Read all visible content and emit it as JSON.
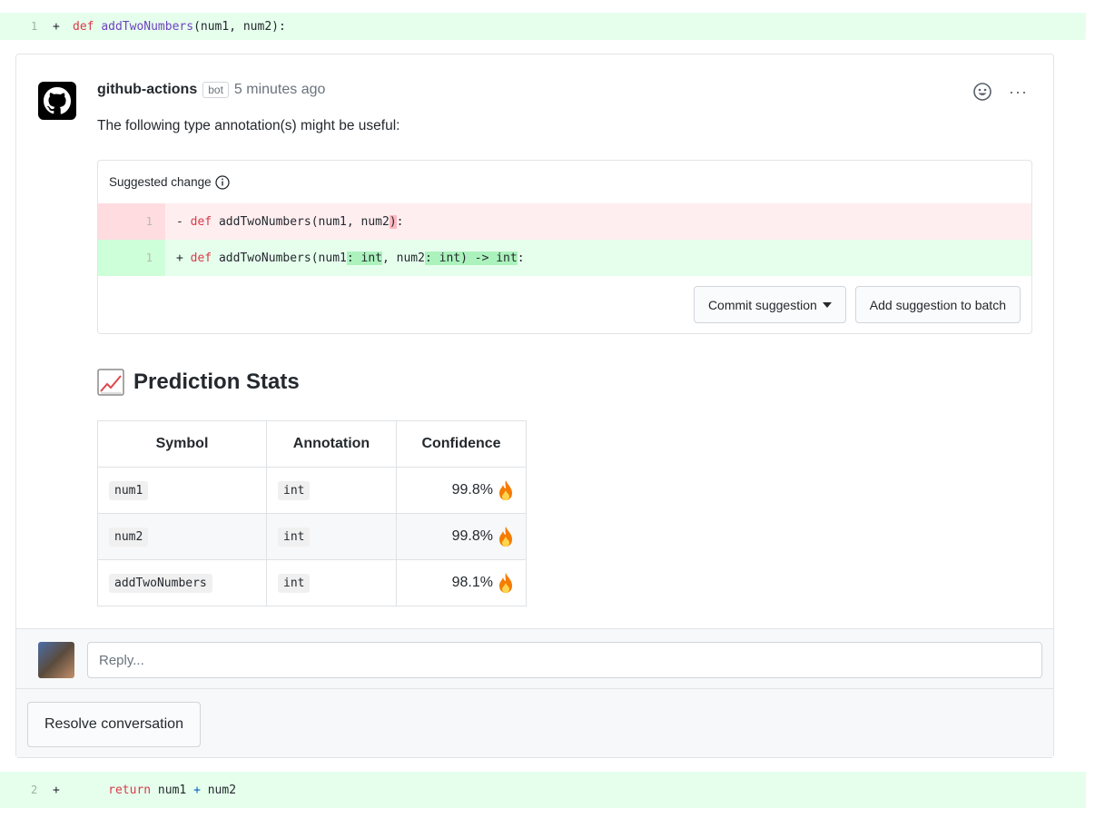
{
  "top_diff": {
    "line_number": "1",
    "sign": "+",
    "keyword": "def",
    "function": "addTwoNumbers",
    "args": "(num1, num2):"
  },
  "comment": {
    "author": "github-actions",
    "badge": "bot",
    "time": "5 minutes ago",
    "text": "The following type annotation(s) might be useful:",
    "more_label": "···"
  },
  "suggestion": {
    "header": "Suggested change",
    "deleted": {
      "line_number": "1",
      "sign": "-",
      "keyword": "def",
      "code_pre": " addTwoNumbers(num1, num2",
      "code_hl": ")",
      "code_post": ":"
    },
    "added": {
      "line_number": "1",
      "sign": "+",
      "keyword": "def",
      "seg1": " addTwoNumbers(num1",
      "hl1": ": int",
      "seg2": ", num2",
      "hl2": ": int) -> int",
      "seg3": ":"
    },
    "commit_label": "Commit suggestion",
    "batch_label": "Add suggestion to batch"
  },
  "stats": {
    "title": "Prediction Stats",
    "columns": [
      "Symbol",
      "Annotation",
      "Confidence"
    ],
    "rows": [
      {
        "symbol": "num1",
        "annotation": "int",
        "confidence": "99.8%"
      },
      {
        "symbol": "num2",
        "annotation": "int",
        "confidence": "99.8%"
      },
      {
        "symbol": "addTwoNumbers",
        "annotation": "int",
        "confidence": "98.1%"
      }
    ]
  },
  "reply": {
    "placeholder": "Reply..."
  },
  "resolve": {
    "label": "Resolve conversation"
  },
  "bottom_diff": {
    "line_number": "2",
    "sign": "+",
    "keyword": "return",
    "expr_a": " num1 ",
    "operator": "+",
    "expr_b": " num2"
  },
  "colors": {
    "add_bg": "#e6ffed",
    "del_bg": "#ffeef0",
    "keyword": "#d73a49",
    "function": "#6f42c1"
  }
}
